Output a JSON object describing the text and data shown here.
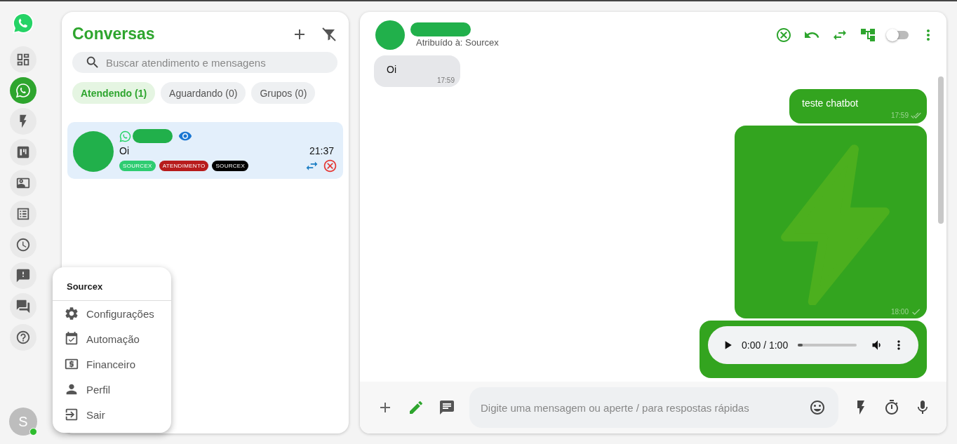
{
  "sidebar": {
    "items": [
      {
        "kind": "dashboard",
        "selected": false
      },
      {
        "kind": "whatsapp",
        "selected": true
      },
      {
        "kind": "flash",
        "selected": false
      },
      {
        "kind": "kanban",
        "selected": false
      },
      {
        "kind": "contacts",
        "selected": false
      },
      {
        "kind": "list",
        "selected": false
      },
      {
        "kind": "clock",
        "selected": false
      },
      {
        "kind": "report",
        "selected": false
      },
      {
        "kind": "forum",
        "selected": false
      },
      {
        "kind": "help",
        "selected": false
      }
    ],
    "user": {
      "initial": "S",
      "online": true
    }
  },
  "conversations": {
    "title": "Conversas",
    "search": {
      "placeholder": "Buscar atendimento e mensagens"
    },
    "tabs": [
      {
        "label": "Atendendo (1)",
        "selected": true
      },
      {
        "label": "Aguardando (0)",
        "selected": false
      },
      {
        "label": "Grupos (0)",
        "selected": false
      }
    ],
    "chats": [
      {
        "message": "Oi",
        "time": "21:37",
        "selected": true,
        "tags": [
          {
            "label": "SOURCEX",
            "color": "#2ecc71"
          },
          {
            "label": "ATENDIMENTO",
            "color": "#b71c1c"
          },
          {
            "label": "SOURCEX",
            "color": "#000000"
          }
        ]
      }
    ]
  },
  "chat": {
    "assigned": "Atribuído à: Sourcex",
    "toggle_on": false,
    "messages": [
      {
        "kind": "text",
        "outgoing": false,
        "text": "Oi",
        "time": "17:59"
      },
      {
        "kind": "text",
        "outgoing": true,
        "text": "teste chatbot",
        "time": "17:59",
        "read": true
      },
      {
        "outgoing": true,
        "time": "18:00",
        "read": false
      },
      {
        "kind": "audio",
        "outgoing": true,
        "position": "0:00 / 1:00",
        "level": 0.08
      }
    ],
    "composer": {
      "placeholder": "Digite uma mensagem ou aperte / para respostas rápidas"
    }
  },
  "menu": {
    "title": "Sourcex",
    "items": [
      {
        "kind": "settings",
        "label": "Configurações"
      },
      {
        "kind": "automation",
        "label": "Automação"
      },
      {
        "kind": "finance",
        "label": "Financeiro"
      },
      {
        "kind": "profile",
        "label": "Perfil"
      },
      {
        "kind": "logout",
        "label": "Sair"
      }
    ]
  }
}
